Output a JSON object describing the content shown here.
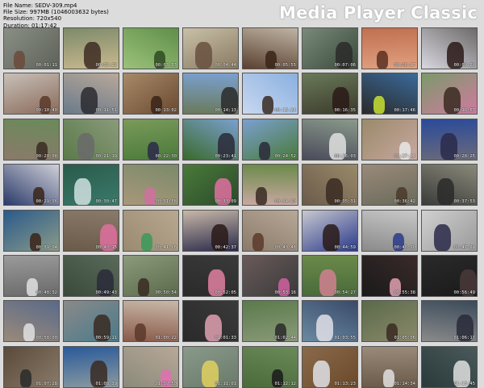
{
  "file_info": {
    "name": "File Name: SEDV-309.mp4",
    "size": "File Size: 997MB (1046003632 bytes)",
    "resolution": "Resolution: 720x540",
    "duration": "Duration: 01:17:42"
  },
  "brand": "Media Player Classic",
  "colors": {
    "background": "#dcdcdc",
    "brand_text": "#ffffff"
  },
  "thumbnails": [
    {
      "time": "00:01:11",
      "c1": "#8a8f86",
      "c2": "#5e6259",
      "f": "#6b4a3a"
    },
    {
      "time": "00:02:22",
      "c1": "#7d8a6a",
      "c2": "#c9b98e",
      "f": "#3d2c22"
    },
    {
      "time": "00:03:33",
      "c1": "#5f8f4a",
      "c2": "#9cc27a",
      "f": "#2f4a22"
    },
    {
      "time": "00:04:44",
      "c1": "#c9c0a8",
      "c2": "#8a7a62",
      "f": "#6a5040"
    },
    {
      "time": "00:05:55",
      "c1": "#bfb4a4",
      "c2": "#5a4030",
      "f": "#3a2418"
    },
    {
      "time": "00:07:06",
      "c1": "#7a8a7a",
      "c2": "#3a4a3a",
      "f": "#2a2a2a"
    },
    {
      "time": "00:08:17",
      "c1": "#c07050",
      "c2": "#e0a080",
      "f": "#5a3020"
    },
    {
      "time": "00:09:28",
      "c1": "#6e6a6a",
      "c2": "#d8d8e0",
      "f": "#2a1a18"
    },
    {
      "time": "00:10:40",
      "c1": "#c8c0b8",
      "c2": "#8a6a5a",
      "f": "#5a3a2a"
    },
    {
      "time": "00:11:51",
      "c1": "#b8a89a",
      "c2": "#6a7a8a",
      "f": "#2a2a30"
    },
    {
      "time": "00:13:02",
      "c1": "#a88a6a",
      "c2": "#6a4a30",
      "f": "#3a2418"
    },
    {
      "time": "00:14:13",
      "c1": "#7aa0d0",
      "c2": "#6a7a5a",
      "f": "#2a2a2a"
    },
    {
      "time": "00:15:24",
      "c1": "#8ab0e0",
      "c2": "#c8d8f0",
      "f": "#3a2a22"
    },
    {
      "time": "00:16:35",
      "c1": "#6a7a5a",
      "c2": "#3a3a2a",
      "f": "#2a1a18"
    },
    {
      "time": "00:17:46",
      "c1": "#3a6a9a",
      "c2": "#2a2a2a",
      "f": "#c8e030"
    },
    {
      "time": "00:18:57",
      "c1": "#7a9a6a",
      "c2": "#d07aa0",
      "f": "#3a2a22"
    },
    {
      "time": "00:20:08",
      "c1": "#6a8a5a",
      "c2": "#8a7a6a",
      "f": "#3a2a22"
    },
    {
      "time": "00:21:19",
      "c1": "#8a9a7a",
      "c2": "#5a7a4a",
      "f": "#6a6a6a"
    },
    {
      "time": "00:22:30",
      "c1": "#7a9a5a",
      "c2": "#4a7a3a",
      "f": "#2a2a4a"
    },
    {
      "time": "00:23:41",
      "c1": "#7aa0d0",
      "c2": "#3a6a2a",
      "f": "#2a2a3a"
    },
    {
      "time": "00:24:52",
      "c1": "#7aa0d0",
      "c2": "#4a7a3a",
      "f": "#2a2a3a"
    },
    {
      "time": "00:26:03",
      "c1": "#8a9a8a",
      "c2": "#4a4a5a",
      "f": "#e0e0e0"
    },
    {
      "time": "00:27:14",
      "c1": "#9a8a6a",
      "c2": "#c8a8a0",
      "f": "#e8e8e8"
    },
    {
      "time": "00:28:25",
      "c1": "#2a4a9a",
      "c2": "#6a6a7a",
      "f": "#2a2a4a"
    },
    {
      "time": "00:29:36",
      "c1": "#d0d0d8",
      "c2": "#2a3a6a",
      "f": "#3a2418"
    },
    {
      "time": "00:30:47",
      "c1": "#2a5a4a",
      "c2": "#3a7a6a",
      "f": "#d0e0e0"
    },
    {
      "time": "00:31:58",
      "c1": "#7a8a6a",
      "c2": "#a8987a",
      "f": "#d070a0"
    },
    {
      "time": "00:33:09",
      "c1": "#4a7a3a",
      "c2": "#2a4a2a",
      "f": "#e070a0"
    },
    {
      "time": "00:34:20",
      "c1": "#6a8a4a",
      "c2": "#c8a8a0",
      "f": "#3a2a22"
    },
    {
      "time": "00:35:31",
      "c1": "#9a8a6a",
      "c2": "#6a5a4a",
      "f": "#3a2a22"
    },
    {
      "time": "00:36:42",
      "c1": "#9a8a7a",
      "c2": "#6a6a5a",
      "f": "#4a3a2a"
    },
    {
      "time": "00:37:53",
      "c1": "#8a8a7a",
      "c2": "#3a3a3a",
      "f": "#2a2a2a"
    },
    {
      "time": "00:39:04",
      "c1": "#2a5a8a",
      "c2": "#8a9a8a",
      "f": "#3a2418"
    },
    {
      "time": "00:40:15",
      "c1": "#8a7a6a",
      "c2": "#6a5a4a",
      "f": "#e070a0"
    },
    {
      "time": "00:41:26",
      "c1": "#b8a890",
      "c2": "#9a8a70",
      "f": "#3a9a5a"
    },
    {
      "time": "00:42:37",
      "c1": "#c8b8a8",
      "c2": "#2a2a4a",
      "f": "#2a1a18"
    },
    {
      "time": "00:43:48",
      "c1": "#b8a898",
      "c2": "#8a7a6a",
      "f": "#5a3a2a"
    },
    {
      "time": "00:44:59",
      "c1": "#c8c8d0",
      "c2": "#2a3a8a",
      "f": "#2a1a18"
    },
    {
      "time": "00:46:10",
      "c1": "#c8c8c8",
      "c2": "#8a8a8a",
      "f": "#2a3a8a"
    },
    {
      "time": "00:47:21",
      "c1": "#d0d0d0",
      "c2": "#9a9a9a",
      "f": "#2a2a4a"
    },
    {
      "time": "00:48:32",
      "c1": "#9a9a9a",
      "c2": "#6a6a6a",
      "f": "#e0e0e0"
    },
    {
      "time": "00:49:43",
      "c1": "#5a6a5a",
      "c2": "#3a4a3a",
      "f": "#2a2a3a"
    },
    {
      "time": "00:50:54",
      "c1": "#8a9a7a",
      "c2": "#5a6a4a",
      "f": "#3a2a22"
    },
    {
      "time": "00:52:05",
      "c1": "#3a3a3a",
      "c2": "#2a2a2a",
      "f": "#e080a0"
    },
    {
      "time": "00:53:16",
      "c1": "#6a5a5a",
      "c2": "#3a3a3a",
      "f": "#d060a0"
    },
    {
      "time": "00:54:27",
      "c1": "#6a8a4a",
      "c2": "#4a6a3a",
      "f": "#d08090"
    },
    {
      "time": "00:55:38",
      "c1": "#3a2a2a",
      "c2": "#1a1a1a",
      "f": "#e0a0b0"
    },
    {
      "time": "00:56:49",
      "c1": "#2a2a2a",
      "c2": "#1a1a1a",
      "f": "#4a3a3a"
    },
    {
      "time": "00:58:00",
      "c1": "#5a6a8a",
      "c2": "#9a8a7a",
      "f": "#e0e0e0"
    },
    {
      "time": "00:59:11",
      "c1": "#8a8a8a",
      "c2": "#4a7a8a",
      "f": "#3a2a22"
    },
    {
      "time": "01:00:22",
      "c1": "#c8b8a8",
      "c2": "#8a5a4a",
      "f": "#5a3a2a"
    },
    {
      "time": "01:01:33",
      "c1": "#3a3a3a",
      "c2": "#2a2a2a",
      "f": "#e0a0b0"
    },
    {
      "time": "01:02:44",
      "c1": "#5a7a4a",
      "c2": "#8a9a7a",
      "f": "#2a2a2a"
    },
    {
      "time": "01:03:55",
      "c1": "#3a4a6a",
      "c2": "#6a8aa0",
      "f": "#e0e0e8"
    },
    {
      "time": "01:05:06",
      "c1": "#5a6a4a",
      "c2": "#8a8a6a",
      "f": "#3a2a22"
    },
    {
      "time": "01:06:17",
      "c1": "#3a4a5a",
      "c2": "#8a8a8a",
      "f": "#2a2a3a"
    },
    {
      "time": "01:07:28",
      "c1": "#5a4a3a",
      "c2": "#8a7a6a",
      "f": "#2a2a2a"
    },
    {
      "time": "01:08:39",
      "c1": "#2a5a9a",
      "c2": "#8a9aa0",
      "f": "#3a2a22"
    },
    {
      "time": "01:09:50",
      "c1": "#b8a898",
      "c2": "#8a8a7a",
      "f": "#e070b0"
    },
    {
      "time": "01:11:01",
      "c1": "#8a9a8a",
      "c2": "#6a7a6a",
      "f": "#e0d060"
    },
    {
      "time": "01:12:12",
      "c1": "#6a8a5a",
      "c2": "#4a6a3a",
      "f": "#1a1a1a"
    },
    {
      "time": "01:13:23",
      "c1": "#8a6a4a",
      "c2": "#6a4a2a",
      "f": "#e0e0e8"
    },
    {
      "time": "01:14:34",
      "c1": "#9a8a7a",
      "c2": "#6a5a4a",
      "f": "#e0e0e0"
    },
    {
      "time": "01:15:45",
      "c1": "#4a5a5a",
      "c2": "#2a3a3a",
      "f": "#e0e0e0"
    }
  ]
}
